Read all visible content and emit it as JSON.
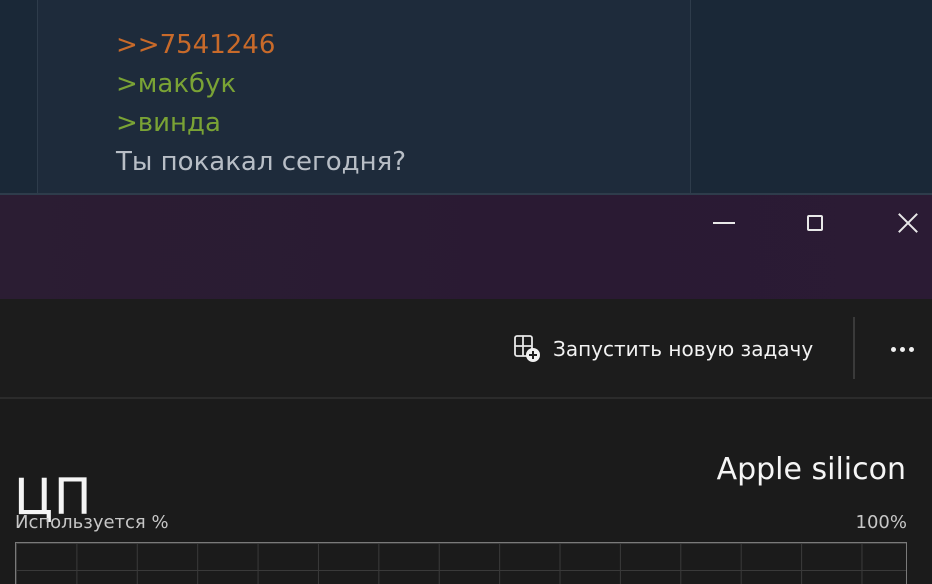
{
  "background_post": {
    "lines": [
      {
        "text": ">>7541246",
        "kind": "reply",
        "color": "#c86a2a"
      },
      {
        "text": ">макбук",
        "kind": "quote",
        "color": "#7aa335"
      },
      {
        "text": ">винда",
        "kind": "quote",
        "color": "#7aa335"
      },
      {
        "text": "Ты покакал сегодня?",
        "kind": "plain",
        "color": "#b8bec6"
      }
    ]
  },
  "window": {
    "controls": {
      "minimize_icon": "minimize-icon",
      "maximize_icon": "maximize-icon",
      "close_icon": "close-icon"
    },
    "titlebar_color": "#2b1d33"
  },
  "commandbar": {
    "run_new_task": {
      "label": "Запустить новую задачу",
      "icon": "new-task-icon"
    },
    "more_icon": "more-options-icon"
  },
  "performance": {
    "title": "ЦП",
    "device_name": "Apple silicon",
    "graph": {
      "usage_label": "Используется %",
      "max_label": "100%",
      "grid": true,
      "border_color": "#7a7a7a",
      "grid_color": "#3a3a3a"
    }
  }
}
